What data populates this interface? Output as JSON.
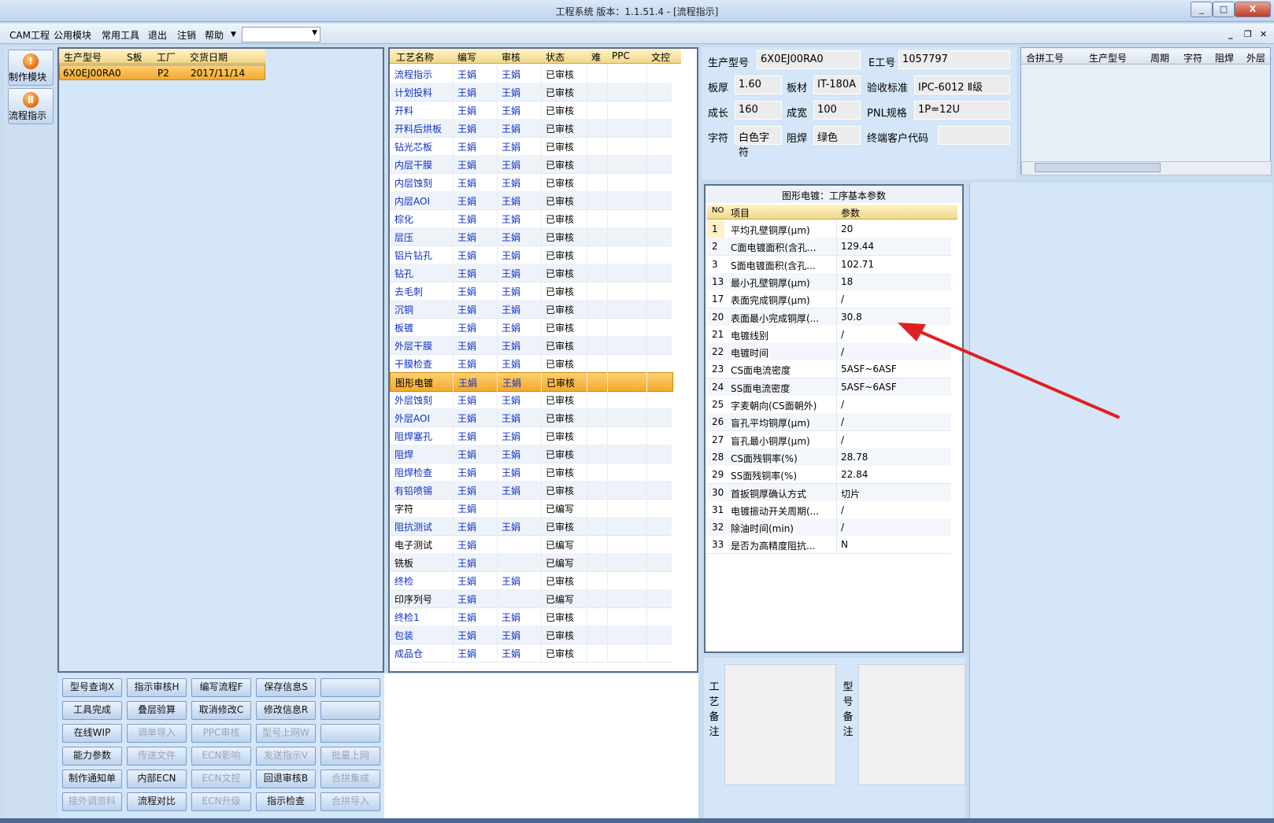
{
  "window": {
    "title": "工程系统   版本：1.1.51.4 - [流程指示]",
    "min": "_",
    "max": "□",
    "close": "X"
  },
  "menu": {
    "items": [
      "CAM工程",
      "公用模块",
      "常用工具",
      "退出",
      "注销",
      "帮助"
    ],
    "combo_value": ""
  },
  "sidebar": {
    "buttons": [
      "制作模块",
      "流程指示"
    ]
  },
  "orders": {
    "headers": [
      "生产型号",
      "S板",
      "工厂",
      "交货日期"
    ],
    "rows": [
      [
        "6X0EJ00RA0",
        "",
        "P2",
        "2017/11/14"
      ]
    ]
  },
  "process": {
    "headers": [
      "工艺名称",
      "编写",
      "审核",
      "状态",
      "难",
      "PPC",
      "文控"
    ],
    "selected_index": 17,
    "rows": [
      [
        "流程指示",
        "王娟",
        "王娟",
        "已审核"
      ],
      [
        "计划投料",
        "王娟",
        "王娟",
        "已审核"
      ],
      [
        "开料",
        "王娟",
        "王娟",
        "已审核"
      ],
      [
        "开料后烘板",
        "王娟",
        "王娟",
        "已审核"
      ],
      [
        "钻光芯板",
        "王娟",
        "王娟",
        "已审核"
      ],
      [
        "内层干膜",
        "王娟",
        "王娟",
        "已审核"
      ],
      [
        "内层蚀刻",
        "王娟",
        "王娟",
        "已审核"
      ],
      [
        "内层AOI",
        "王娟",
        "王娟",
        "已审核"
      ],
      [
        "棕化",
        "王娟",
        "王娟",
        "已审核"
      ],
      [
        "层压",
        "王娟",
        "王娟",
        "已审核"
      ],
      [
        "铝片钻孔",
        "王娟",
        "王娟",
        "已审核"
      ],
      [
        "钻孔",
        "王娟",
        "王娟",
        "已审核"
      ],
      [
        "去毛刺",
        "王娟",
        "王娟",
        "已审核"
      ],
      [
        "沉铜",
        "王娟",
        "王娟",
        "已审核"
      ],
      [
        "板镀",
        "王娟",
        "王娟",
        "已审核"
      ],
      [
        "外层干膜",
        "王娟",
        "王娟",
        "已审核"
      ],
      [
        "干膜检查",
        "王娟",
        "王娟",
        "已审核"
      ],
      [
        "图形电镀",
        "王娟",
        "王娟",
        "已审核"
      ],
      [
        "外层蚀刻",
        "王娟",
        "王娟",
        "已审核"
      ],
      [
        "外层AOI",
        "王娟",
        "王娟",
        "已审核"
      ],
      [
        "阻焊塞孔",
        "王娟",
        "王娟",
        "已审核"
      ],
      [
        "阻焊",
        "王娟",
        "王娟",
        "已审核"
      ],
      [
        "阻焊检查",
        "王娟",
        "王娟",
        "已审核"
      ],
      [
        "有铅喷锡",
        "王娟",
        "王娟",
        "已审核"
      ],
      [
        "字符",
        "王娟",
        "",
        "已编写"
      ],
      [
        "阻抗测试",
        "王娟",
        "王娟",
        "已审核"
      ],
      [
        "电子测试",
        "王娟",
        "",
        "已编写"
      ],
      [
        "铣板",
        "王娟",
        "",
        "已编写"
      ],
      [
        "终检",
        "王娟",
        "王娟",
        "已审核"
      ],
      [
        "印序列号",
        "王娟",
        "",
        "已编写"
      ],
      [
        "终检1",
        "王娟",
        "王娟",
        "已审核"
      ],
      [
        "包装",
        "王娟",
        "王娟",
        "已审核"
      ],
      [
        "成品仓",
        "王娟",
        "王娟",
        "已审核"
      ]
    ]
  },
  "info": {
    "part_no_label": "生产型号",
    "part_no": "6X0EJ00RA0",
    "eng_no_label": "E工号",
    "eng_no": "1057797",
    "thickness_label": "板厚",
    "thickness": "1.60",
    "material_label": "板材",
    "material": "IT-180A",
    "standard_label": "验收标准",
    "standard": "IPC-6012 Ⅱ级",
    "length_label": "成长",
    "length": "160",
    "width_label": "成宽",
    "width": "100",
    "pnl_label": "PNL规格",
    "pnl": "1P=12U",
    "char_label": "字符",
    "char": "白色字符",
    "mask_label": "阻焊",
    "mask": "绿色",
    "end_customer_label": "终端客户代码",
    "end_customer": ""
  },
  "merge": {
    "headers": [
      "合拼工号",
      "生产型号",
      "周期",
      "字符",
      "阻焊",
      "外层"
    ]
  },
  "params": {
    "title": "图形电镀：工序基本参数",
    "headers": [
      "NO",
      "项目",
      "参数"
    ],
    "rows": [
      [
        "1",
        "平均孔壁铜厚(μm)",
        "20"
      ],
      [
        "2",
        "C面电镀面积(含孔...",
        "129.44"
      ],
      [
        "3",
        "S面电镀面积(含孔...",
        "102.71"
      ],
      [
        "13",
        "最小孔壁铜厚(μm)",
        "18"
      ],
      [
        "17",
        "表面完成铜厚(μm)",
        "/"
      ],
      [
        "20",
        "表面最小完成铜厚(...",
        "30.8"
      ],
      [
        "21",
        "电镀线别",
        "/"
      ],
      [
        "22",
        "电镀时间",
        "/"
      ],
      [
        "23",
        "CS面电流密度",
        "5ASF~6ASF"
      ],
      [
        "24",
        "SS面电流密度",
        "5ASF~6ASF"
      ],
      [
        "25",
        "字麦朝向(CS面朝外)",
        "/"
      ],
      [
        "26",
        "盲孔平均铜厚(μm)",
        "/"
      ],
      [
        "27",
        "盲孔最小铜厚(μm)",
        "/"
      ],
      [
        "28",
        "CS面残铜率(%)",
        "28.78"
      ],
      [
        "29",
        "SS面残铜率(%)",
        "22.84"
      ],
      [
        "30",
        "首扳铜厚确认方式",
        "切片"
      ],
      [
        "31",
        "电镀振动开关周期(...",
        "/"
      ],
      [
        "32",
        "除油时间(min)",
        "/"
      ],
      [
        "33",
        "是否为高精度阻抗...",
        "N"
      ]
    ]
  },
  "memo": {
    "process_label": [
      "工",
      "艺",
      "备",
      "注"
    ],
    "model_label": [
      "型",
      "号",
      "备",
      "注"
    ]
  },
  "buttons": [
    [
      {
        "t": "型号查询X",
        "d": false
      },
      {
        "t": "指示审核H",
        "d": false
      },
      {
        "t": "编写流程F",
        "d": false
      },
      {
        "t": "保存信息S",
        "d": false
      },
      {
        "t": "",
        "d": false
      }
    ],
    [
      {
        "t": "工具完成",
        "d": false
      },
      {
        "t": "叠层验算",
        "d": false
      },
      {
        "t": "取消修改C",
        "d": false
      },
      {
        "t": "修改信息R",
        "d": false
      },
      {
        "t": "",
        "d": false
      }
    ],
    [
      {
        "t": "在线WIP",
        "d": false
      },
      {
        "t": "调单导入",
        "d": true
      },
      {
        "t": "PPC审核",
        "d": true
      },
      {
        "t": "型号上网W",
        "d": true
      },
      {
        "t": "",
        "d": false
      }
    ],
    [
      {
        "t": "能力参数",
        "d": false
      },
      {
        "t": "传送文件",
        "d": true
      },
      {
        "t": "ECN影响",
        "d": true
      },
      {
        "t": "发送指示V",
        "d": true
      },
      {
        "t": "批量上网",
        "d": true
      }
    ],
    [
      {
        "t": "制作通知单",
        "d": false
      },
      {
        "t": "内部ECN",
        "d": false
      },
      {
        "t": "ECN文控",
        "d": true
      },
      {
        "t": "回退审核B",
        "d": false
      },
      {
        "t": "合拼集成",
        "d": true
      }
    ],
    [
      {
        "t": "接外调资料",
        "d": true
      },
      {
        "t": "流程对比",
        "d": false
      },
      {
        "t": "ECN升级",
        "d": true
      },
      {
        "t": "指示检查",
        "d": false
      },
      {
        "t": "合拼导入",
        "d": true
      }
    ]
  ],
  "colors": {
    "accent_arrow": "#e02020",
    "selected_row": "#f3a92f",
    "link_text": "#1030c0"
  }
}
